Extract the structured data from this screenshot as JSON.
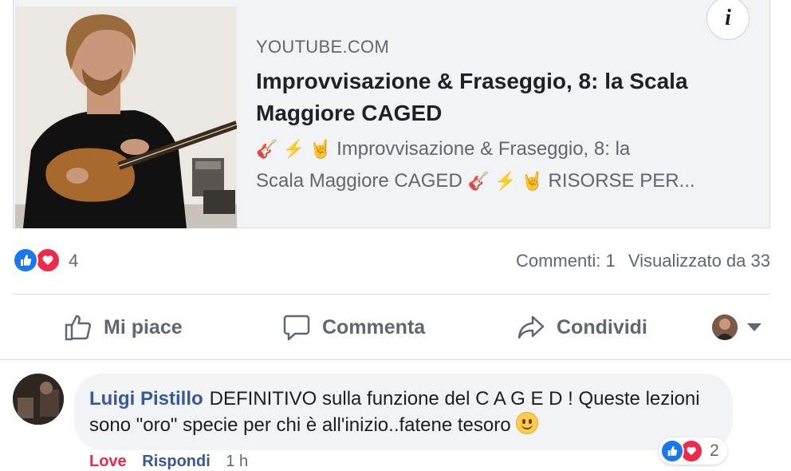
{
  "link_preview": {
    "domain": "YOUTUBE.COM",
    "title": "Improvvisazione & Fraseggio, 8: la Scala Maggiore CAGED",
    "description_line1_emoji": "🎸 ⚡ 🤘",
    "description_line1_text": "Improvvisazione & Fraseggio, 8: la",
    "description_line2_text": "Scala Maggiore CAGED",
    "description_line2_emoji": "🎸 ⚡ 🤘",
    "description_line2_tail": "RISORSE PER...",
    "info_label": "i"
  },
  "reactions": {
    "count": "4",
    "comments": "Commenti: 1",
    "seen_by": "Visualizzato da 33"
  },
  "actions": {
    "like": "Mi piace",
    "comment": "Commenta",
    "share": "Condividi"
  },
  "comment": {
    "author": "Luigi Pistillo",
    "text": "DEFINITIVO sulla funzione del C A G E D ! Queste lezioni sono \"oro\" specie per chi è all'inizio..fatene tesoro",
    "reaction_count": "2",
    "love_link": "Love",
    "reply_link": "Rispondi",
    "time": "1 h"
  },
  "colors": {
    "like_blue": "#1877f2",
    "love_red": "#f0284a",
    "link_blue": "#385898",
    "muted_text": "#606770"
  }
}
